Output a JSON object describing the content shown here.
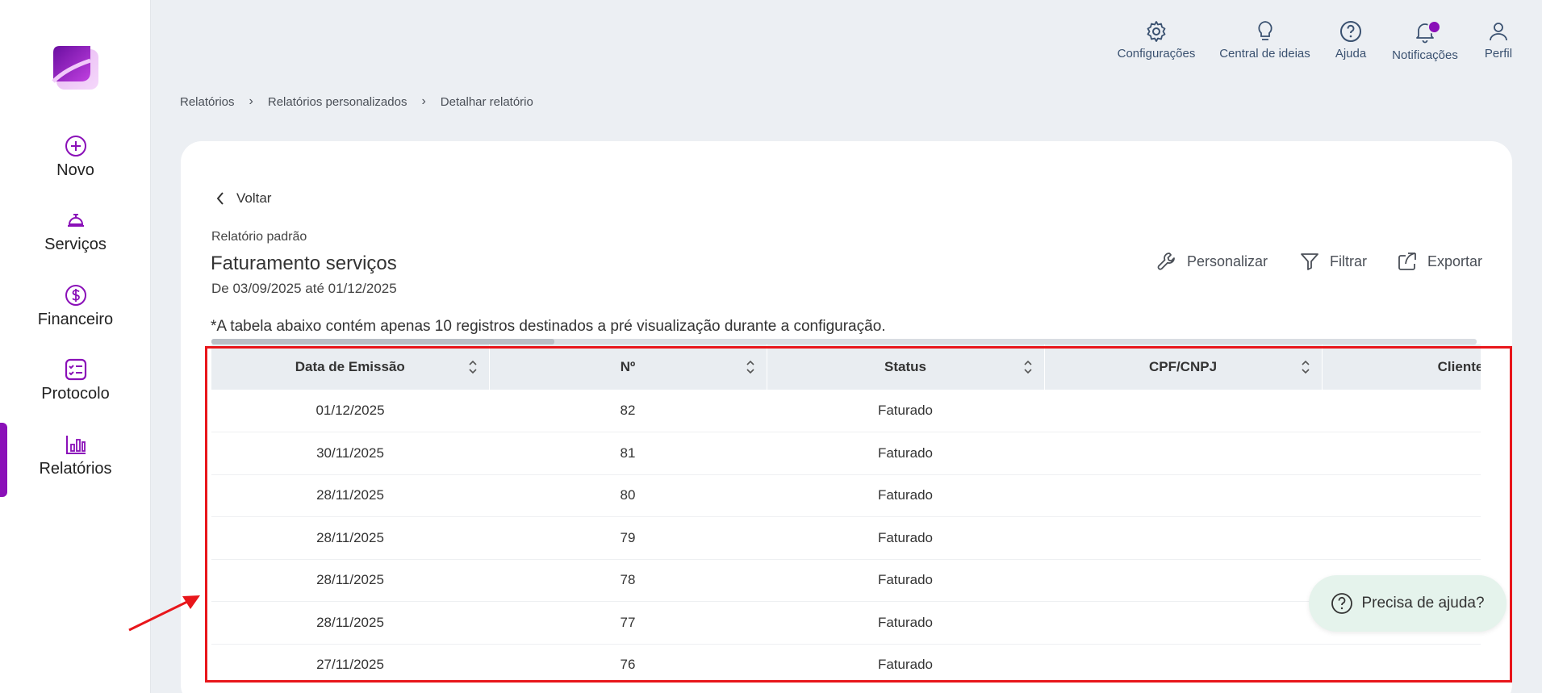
{
  "sidebar": {
    "items": [
      {
        "label": "Novo",
        "icon": "plus-circle-icon"
      },
      {
        "label": "Serviços",
        "icon": "service-bell-icon"
      },
      {
        "label": "Financeiro",
        "icon": "dollar-circle-icon"
      },
      {
        "label": "Protocolo",
        "icon": "checklist-icon"
      },
      {
        "label": "Relatórios",
        "icon": "bar-chart-icon"
      }
    ],
    "active": "Relatórios",
    "accent": "#8a10b8"
  },
  "topbar": {
    "items": [
      {
        "label": "Configurações",
        "icon": "gear-icon"
      },
      {
        "label": "Central de ideias",
        "icon": "lightbulb-icon"
      },
      {
        "label": "Ajuda",
        "icon": "help-circle-icon"
      },
      {
        "label": "Notificações",
        "icon": "bell-icon"
      },
      {
        "label": "Perfil",
        "icon": "user-icon"
      }
    ]
  },
  "breadcrumb": [
    "Relatórios",
    "Relatórios personalizados",
    "Detalhar relatório"
  ],
  "page": {
    "back_label": "Voltar",
    "subtitle": "Relatório padrão",
    "title": "Faturamento serviços",
    "date_range": "De 03/09/2025 até 01/12/2025",
    "notice": "*A tabela abaixo contém apenas 10 registros destinados a pré visualização durante a configuração."
  },
  "actions": {
    "customize": "Personalizar",
    "filter": "Filtrar",
    "export": "Exportar"
  },
  "table": {
    "headers": [
      "Data de Emissão",
      "Nº",
      "Status",
      "CPF/CNPJ",
      "Cliente"
    ],
    "rows": [
      [
        "01/12/2025",
        "82",
        "Faturado",
        "",
        ""
      ],
      [
        "30/11/2025",
        "81",
        "Faturado",
        "",
        ""
      ],
      [
        "28/11/2025",
        "80",
        "Faturado",
        "",
        ""
      ],
      [
        "28/11/2025",
        "79",
        "Faturado",
        "",
        ""
      ],
      [
        "28/11/2025",
        "78",
        "Faturado",
        "",
        ""
      ],
      [
        "28/11/2025",
        "77",
        "Faturado",
        "",
        ""
      ],
      [
        "27/11/2025",
        "76",
        "Faturado",
        "",
        ""
      ]
    ]
  },
  "help": {
    "label": "Precisa de ajuda?"
  },
  "annotation": {
    "color": "#e8161b"
  }
}
